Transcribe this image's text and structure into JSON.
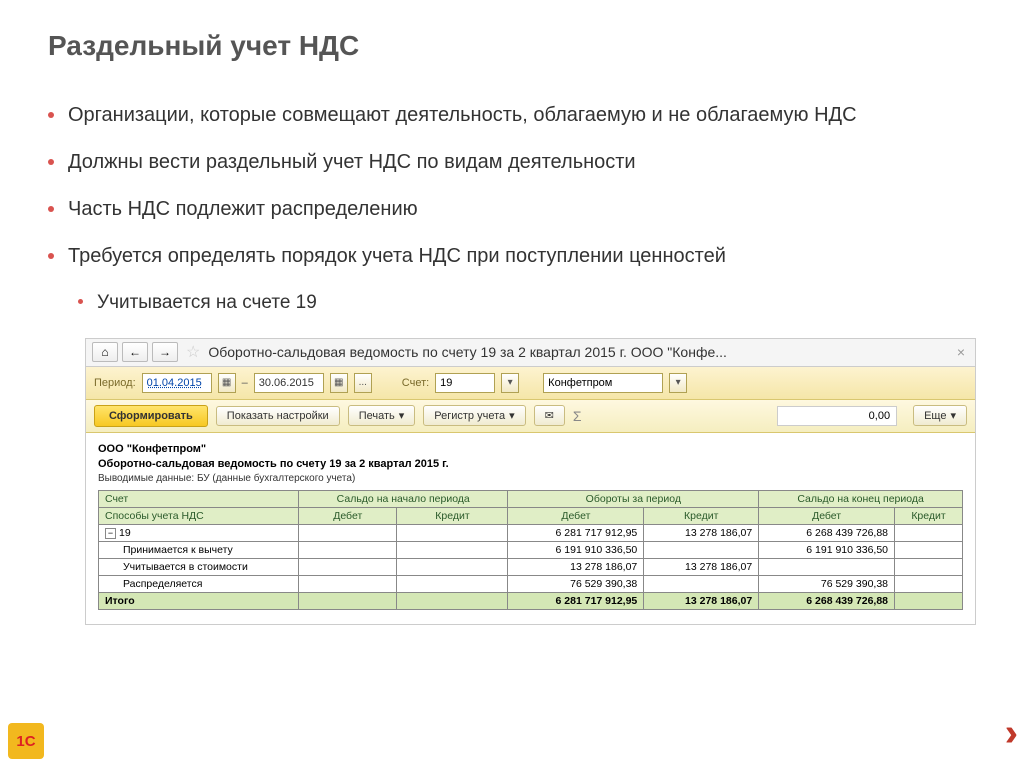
{
  "slide": {
    "title": "Раздельный учет НДС",
    "bullets": [
      "Организации, которые совмещают деятельность, облагаемую и не облагаемую НДС",
      "Должны вести раздельный учет НДС по видам деятельности",
      "Часть НДС подлежит распределению",
      "Требуется определять порядок учета НДС при поступлении ценностей"
    ],
    "sub_bullet": "Учитывается на счете 19"
  },
  "window": {
    "title": "Оборотно-сальдовая ведомость по счету 19 за 2 квартал 2015 г. ООО \"Конфе...",
    "params": {
      "period_label": "Период:",
      "date_from": "01.04.2015",
      "date_to": "30.06.2015",
      "dash": "–",
      "acct_label": "Счет:",
      "acct_value": "19",
      "org_value": "Конфетпром",
      "dots": "..."
    },
    "toolbar": {
      "form_btn": "Сформировать",
      "show_settings": "Показать настройки",
      "print": "Печать",
      "register": "Регистр учета",
      "sum_value": "0,00",
      "more": "Еще"
    },
    "report": {
      "org": "ООО \"Конфетпром\"",
      "title": "Оборотно-сальдовая ведомость по счету 19 за 2 квартал 2015 г.",
      "subtitle": "Выводимые данные: БУ (данные бухгалтерского учета)",
      "headers": {
        "acct": "Счет",
        "method": "Способы учета НДС",
        "start": "Сальдо на начало периода",
        "turn": "Обороты за период",
        "end": "Сальдо на конец периода",
        "debit": "Дебет",
        "credit": "Кредит"
      },
      "rows": [
        {
          "label": "19",
          "d_turn": "6 281 717 912,95",
          "c_turn": "13 278 186,07",
          "d_end": "6 268 439 726,88"
        },
        {
          "label": "Принимается к вычету",
          "d_turn": "6 191 910 336,50",
          "c_turn": "",
          "d_end": "6 191 910 336,50"
        },
        {
          "label": "Учитывается в стоимости",
          "d_turn": "13 278 186,07",
          "c_turn": "13 278 186,07",
          "d_end": ""
        },
        {
          "label": "Распределяется",
          "d_turn": "76 529 390,38",
          "c_turn": "",
          "d_end": "76 529 390,38"
        }
      ],
      "total": {
        "label": "Итого",
        "d_turn": "6 281 717 912,95",
        "c_turn": "13 278 186,07",
        "d_end": "6 268 439 726,88"
      }
    }
  },
  "logo": "1C",
  "chevron": "››"
}
